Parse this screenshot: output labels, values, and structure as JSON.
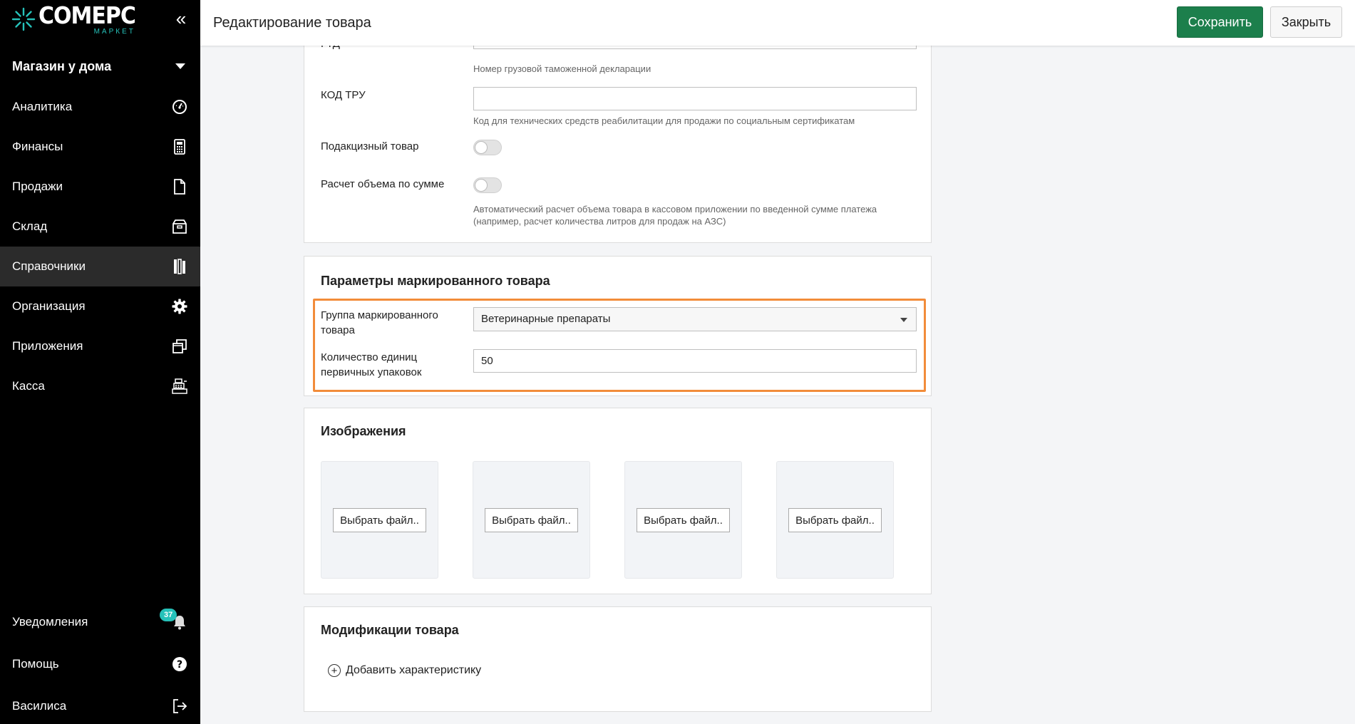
{
  "app": {
    "logo_main": "COMEPC",
    "logo_sub": "МАРКЕТ"
  },
  "sidebar": {
    "shop_name": "Магазин у дома",
    "items": [
      {
        "label": "Аналитика",
        "icon": "gauge-icon"
      },
      {
        "label": "Финансы",
        "icon": "calculator-icon"
      },
      {
        "label": "Продажи",
        "icon": "document-icon"
      },
      {
        "label": "Склад",
        "icon": "box-icon"
      },
      {
        "label": "Справочники",
        "icon": "book-icon",
        "active": true
      },
      {
        "label": "Организация",
        "icon": "gear-icon"
      },
      {
        "label": "Приложения",
        "icon": "windows-icon"
      },
      {
        "label": "Касса",
        "icon": "cash-register-icon"
      }
    ],
    "bottom": [
      {
        "label": "Уведомления",
        "icon": "bell-icon"
      },
      {
        "label": "Помощь",
        "icon": "help-icon"
      },
      {
        "label": "Василиса",
        "icon": "logout-icon"
      }
    ],
    "notifications_count": "37"
  },
  "header": {
    "title": "Редактирование товара",
    "save_label": "Сохранить",
    "close_label": "Закрыть"
  },
  "general": {
    "gtd_label": "ГТД",
    "gtd_value": "",
    "gtd_hint": "Номер грузовой таможенной декларации",
    "tru_label": "КОД ТРУ",
    "tru_value": "",
    "tru_hint": "Код для технических средств реабилитации для продажи по социальным сертификатам",
    "excise_label": "Подакцизный товар",
    "excise_on": false,
    "volume_label": "Расчет объема по сумме",
    "volume_on": false,
    "volume_hint": "Автоматический расчет объема товара в кассовом приложении по введенной сумме платежа (например, расчет количества литров для продаж на АЗС)"
  },
  "marked": {
    "title": "Параметры маркированного товара",
    "group_label": "Группа маркированного товара",
    "group_value": "Ветеринарные препараты",
    "qty_label": "Количество единиц первичных упаковок",
    "qty_value": "50",
    "highlight_color": "#f28c3a"
  },
  "images": {
    "title": "Изображения",
    "button_label": "Выбрать файл.."
  },
  "modifications": {
    "title": "Модификации товара",
    "add_label": "Добавить характеристику"
  },
  "colors": {
    "accent": "#1c7f4c",
    "brand_teal": "#26c1b9",
    "sidebar_bg": "#000000"
  }
}
